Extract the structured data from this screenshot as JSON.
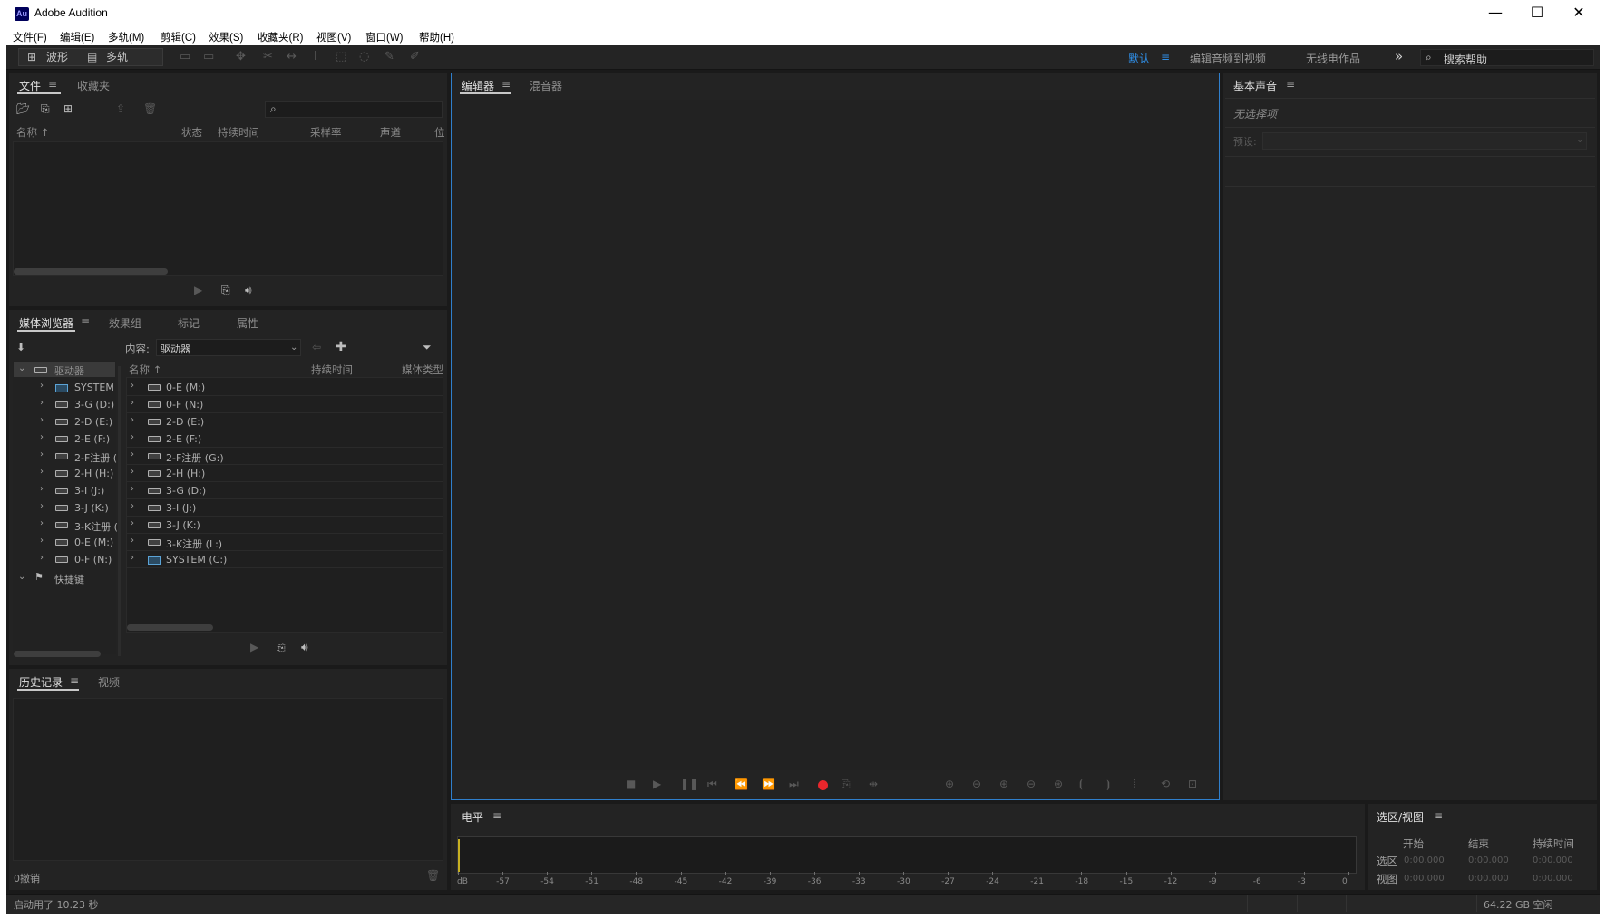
{
  "window": {
    "logo": "Au",
    "title": "Adobe Audition",
    "controls": {
      "minimize": "—",
      "maximize": "☐",
      "close": "✕"
    }
  },
  "menu": [
    "文件(F)",
    "编辑(E)",
    "多轨(M)",
    "剪辑(C)",
    "效果(S)",
    "收藏夹(R)",
    "视图(V)",
    "窗口(W)",
    "帮助(H)"
  ],
  "toolbar": {
    "waveform_label": "波形",
    "multitrack_label": "多轨",
    "workspaces": [
      "默认",
      "编辑音频到视频",
      "无线电作品"
    ],
    "more": "»",
    "search_placeholder": "搜索帮助"
  },
  "files_panel": {
    "tabs": [
      "文件",
      "收藏夹"
    ],
    "columns": [
      "名称 ↑",
      "状态",
      "持续时间",
      "采样率",
      "声道",
      "位"
    ]
  },
  "media_browser": {
    "tabs": [
      "媒体浏览器",
      "效果组",
      "标记",
      "属性"
    ],
    "content_label": "内容:",
    "content_value": "驱动器",
    "tree_root": "驱动器",
    "tree_items": [
      "SYSTEM (",
      "3-G (D:)",
      "2-D (E:)",
      "2-E (F:)",
      "2-F注册 (",
      "2-H (H:)",
      "3-I (J:)",
      "3-J (K:)",
      "3-K注册 (",
      "0-E (M:)",
      "0-F (N:)"
    ],
    "shortcuts_label": "快捷键",
    "columns": [
      "名称 ↑",
      "持续时间",
      "媒体类型"
    ],
    "list_items": [
      "0-E (M:)",
      "0-F (N:)",
      "2-D (E:)",
      "2-E (F:)",
      "2-F注册 (G:)",
      "2-H (H:)",
      "3-G (D:)",
      "3-I (J:)",
      "3-J (K:)",
      "3-K注册 (L:)",
      "SYSTEM (C:)"
    ]
  },
  "history_panel": {
    "tabs": [
      "历史记录",
      "视频"
    ],
    "undo_count": "0撤销"
  },
  "editor_panel": {
    "tabs": [
      "编辑器",
      "混音器"
    ]
  },
  "essential_sound": {
    "title": "基本声音",
    "no_selection": "无选择项",
    "preset_label": "预设:"
  },
  "levels_panel": {
    "title": "电平",
    "ticks": [
      "dB",
      "-57",
      "-54",
      "-51",
      "-48",
      "-45",
      "-42",
      "-39",
      "-36",
      "-33",
      "-30",
      "-27",
      "-24",
      "-21",
      "-18",
      "-15",
      "-12",
      "-9",
      "-6",
      "-3",
      "0"
    ]
  },
  "selection_view": {
    "title": "选区/视图",
    "columns": [
      "开始",
      "结束",
      "持续时间"
    ],
    "rows": [
      {
        "label": "选区",
        "start": "0:00.000",
        "end": "0:00.000",
        "duration": "0:00.000"
      },
      {
        "label": "视图",
        "start": "0:00.000",
        "end": "0:00.000",
        "duration": "0:00.000"
      }
    ]
  },
  "status_bar": {
    "startup": "启动用了 10.23 秒",
    "disk_free": "64.22 GB 空闲"
  },
  "colors": {
    "accent": "#2f8ee6",
    "record": "#e8262c",
    "panel": "#232323",
    "background": "#1a1a1a"
  }
}
